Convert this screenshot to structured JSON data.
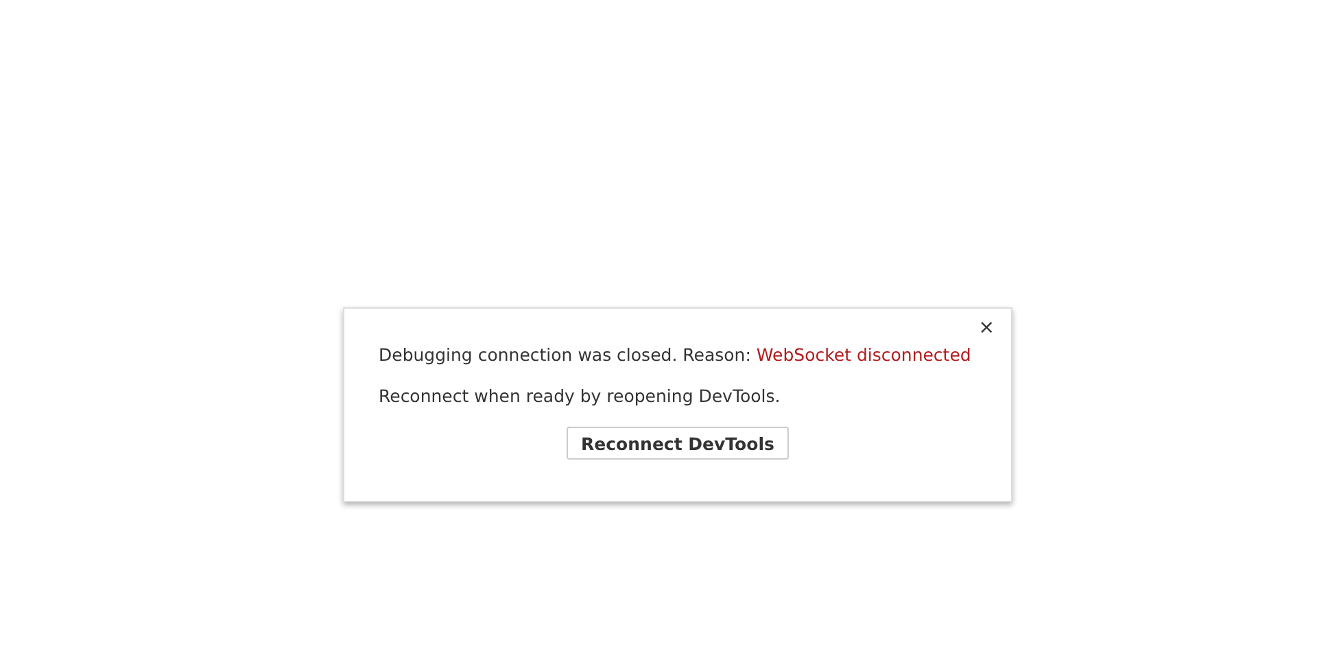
{
  "dialog": {
    "close": "×",
    "message": "Debugging connection was closed. Reason: ",
    "reason": "WebSocket disconnected",
    "hint": "Reconnect when ready by reopening DevTools.",
    "button": "Reconnect DevTools"
  }
}
